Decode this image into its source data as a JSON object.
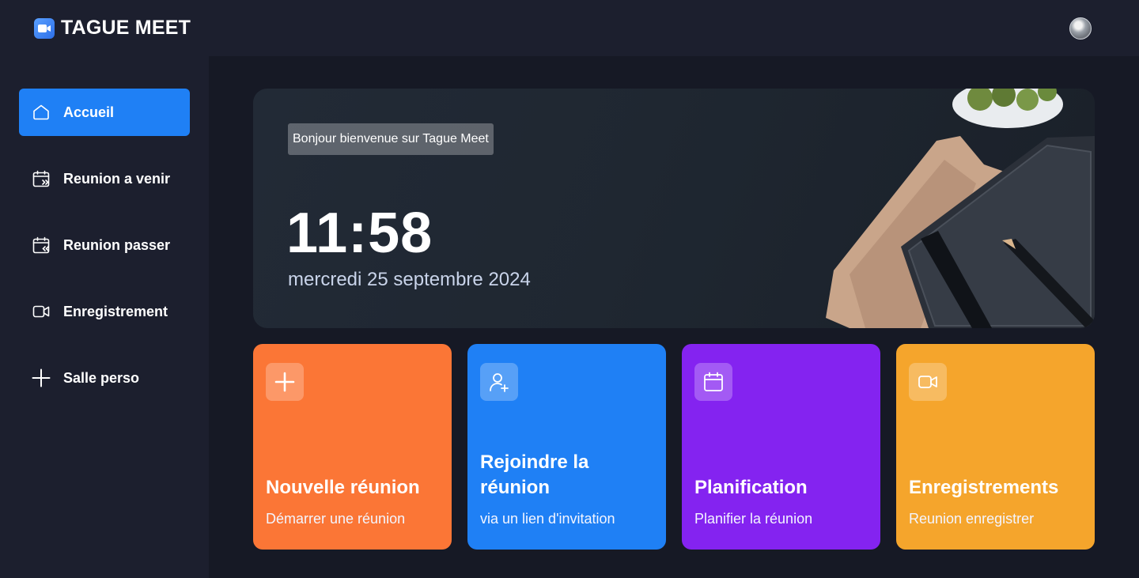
{
  "app": {
    "name": "TAGUE MEET"
  },
  "sidebar": {
    "items": [
      {
        "label": "Accueil",
        "icon": "home-icon",
        "active": true
      },
      {
        "label": "Reunion a venir",
        "icon": "calendar-upcoming-icon",
        "active": false
      },
      {
        "label": "Reunion passer",
        "icon": "calendar-previous-icon",
        "active": false
      },
      {
        "label": "Enregistrement",
        "icon": "video-icon",
        "active": false
      },
      {
        "label": "Salle perso",
        "icon": "plus-icon",
        "active": false
      }
    ]
  },
  "hero": {
    "greeting": "Bonjour bienvenue sur Tague Meet",
    "time": "11:58",
    "date": "mercredi 25 septembre 2024"
  },
  "cards": [
    {
      "title": "Nouvelle réunion",
      "subtitle": "Démarrer une réunion",
      "icon": "plus-icon",
      "color": "#fb7636"
    },
    {
      "title": "Rejoindre la réunion",
      "subtitle": "via un lien d'invitation",
      "icon": "user-plus-icon",
      "color": "#1f80f5"
    },
    {
      "title": "Planification",
      "subtitle": "Planifier la réunion",
      "icon": "calendar-icon",
      "color": "#8423f0"
    },
    {
      "title": "Enregistrements",
      "subtitle": "Reunion enregistrer",
      "icon": "video-icon",
      "color": "#f5a52c"
    }
  ],
  "colors": {
    "accent": "#1f80f5",
    "sidebar_bg": "#1c1f2e",
    "main_bg": "#161925"
  }
}
